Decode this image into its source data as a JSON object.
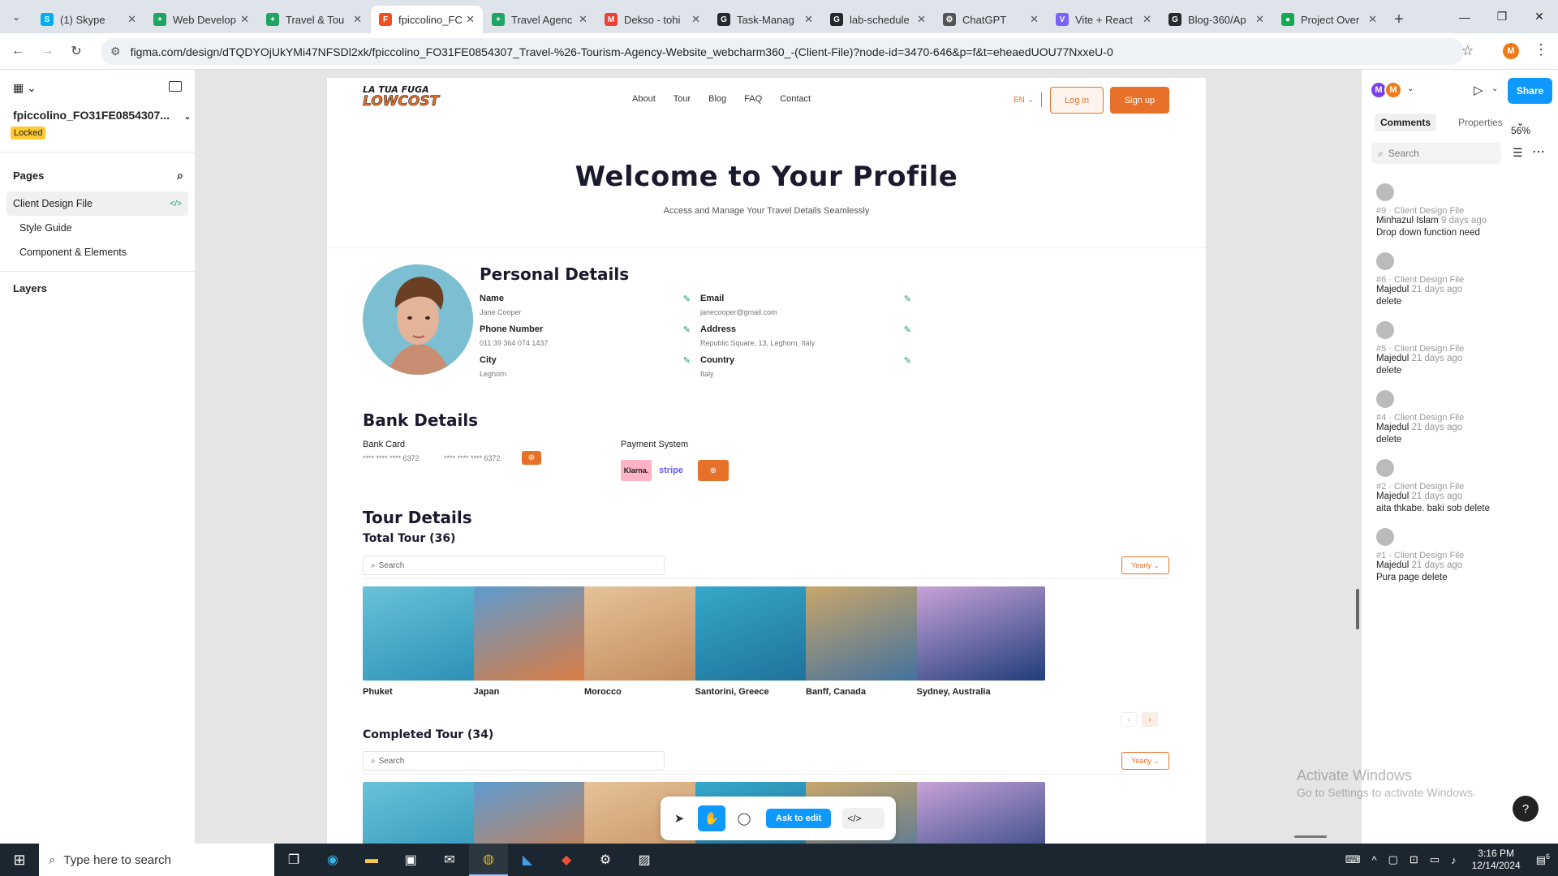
{
  "browser": {
    "tabs": [
      {
        "title": "(1) Skype",
        "icon": "skype",
        "color": "#00aff0",
        "letter": "S"
      },
      {
        "title": "Web Develop",
        "icon": "sheets",
        "color": "#1fa463",
        "letter": "+"
      },
      {
        "title": "Travel & Tou",
        "icon": "sheets",
        "color": "#1fa463",
        "letter": "+"
      },
      {
        "title": "fpiccolino_FC",
        "icon": "figma",
        "color": "#f24e1e",
        "letter": "F",
        "active": true
      },
      {
        "title": "Travel Agenc",
        "icon": "sheets",
        "color": "#1fa463",
        "letter": "+"
      },
      {
        "title": "Dekso - tohi",
        "icon": "gmail",
        "color": "#ea4335",
        "letter": "M"
      },
      {
        "title": "Task-Manag",
        "icon": "github",
        "color": "#24292e",
        "letter": "G"
      },
      {
        "title": "lab-schedule",
        "icon": "github",
        "color": "#24292e",
        "letter": "G"
      },
      {
        "title": "ChatGPT",
        "icon": "openai",
        "color": "#555",
        "letter": "⚙"
      },
      {
        "title": "Vite + React",
        "icon": "vite",
        "color": "#7b61ff",
        "letter": "V"
      },
      {
        "title": "Blog-360/Ap",
        "icon": "github",
        "color": "#24292e",
        "letter": "G"
      },
      {
        "title": "Project Over",
        "icon": "mongodb",
        "color": "#13aa52",
        "letter": "●"
      }
    ],
    "url": "figma.com/design/dTQDYOjUkYMi47NFSDl2xk/fpiccolino_FO31FE0854307_Travel-%26-Tourism-Agency-Website_webcharm360_-(Client-File)?node-id=3470-646&p=f&t=eheaedUOU77NxxeU-0",
    "profile_initial": "M"
  },
  "left_panel": {
    "file_name": "fpiccolino_FO31FE0854307...",
    "locked_badge": "Locked",
    "pages_label": "Pages",
    "pages": [
      "Client Design File",
      "Style Guide",
      "Component & Elements"
    ],
    "layers_label": "Layers"
  },
  "site": {
    "logo_top": "LA TUA FUGA",
    "logo_bottom": "LOWCOST",
    "nav": [
      "About",
      "Tour",
      "Blog",
      "FAQ",
      "Contact"
    ],
    "lang": "EN",
    "login": "Log in",
    "signup": "Sign up",
    "hero_title": "Welcome to Your Profile",
    "hero_sub": "Access and Manage Your Travel Details Seamlessly",
    "personal_title": "Personal Details",
    "fields": {
      "name": {
        "label": "Name",
        "value": "Jane Cooper"
      },
      "email": {
        "label": "Email",
        "value": "janecooper@gmail.com"
      },
      "phone": {
        "label": "Phone Number",
        "value": "011 39 364 074 1437"
      },
      "address": {
        "label": "Address",
        "value": "Republic Square, 13, Leghorn, Italy"
      },
      "city": {
        "label": "City",
        "value": "Leghorn"
      },
      "country": {
        "label": "Country",
        "value": "Italy"
      }
    },
    "bank_title": "Bank Details",
    "bank_card_label": "Bank Card",
    "card1": "**** **** **** 6372",
    "card2": "**** **** **** 6372",
    "payment_label": "Payment System",
    "klarna": "Klarna.",
    "stripe": "stripe",
    "tour_title": "Tour Details",
    "total_tour": "Total Tour (36)",
    "completed_tour": "Completed Tour (34)",
    "search_placeholder": "Search",
    "yearly": "Yearly",
    "tours": [
      "Phuket",
      "Japan",
      "Morocco",
      "Santorini, Greece",
      "Banff, Canada",
      "Sydney, Australia"
    ],
    "tour_colors": [
      [
        "#2a8fb5",
        "#69c2d8"
      ],
      [
        "#e07a3a",
        "#5d9bd0"
      ],
      [
        "#c08a5a",
        "#e6c299"
      ],
      [
        "#1f6f9a",
        "#35a8c8"
      ],
      [
        "#3d6fa0",
        "#c9a66a"
      ],
      [
        "#1f3d7a",
        "#c7a2d8"
      ]
    ]
  },
  "toolbar": {
    "ask_edit": "Ask to edit"
  },
  "right_panel": {
    "avatars": [
      {
        "letter": "M",
        "color": "#7b3ff2"
      },
      {
        "letter": "M",
        "color": "#f07a1a"
      }
    ],
    "share": "Share",
    "tabs": [
      "Comments",
      "Properties"
    ],
    "zoom": "56%",
    "search_placeholder": "Search",
    "comments": [
      {
        "meta": "#9 · Client Design File",
        "author": "Minhazul Islam",
        "ago": "9 days ago",
        "body": "Drop down function need"
      },
      {
        "meta": "#6 · Client Design File",
        "author": "Majedul",
        "ago": "21 days ago",
        "body": "delete"
      },
      {
        "meta": "#5 · Client Design File",
        "author": "Majedul",
        "ago": "21 days ago",
        "body": "delete"
      },
      {
        "meta": "#4 · Client Design File",
        "author": "Majedul",
        "ago": "21 days ago",
        "body": "delete"
      },
      {
        "meta": "#2 · Client Design File",
        "author": "Majedul",
        "ago": "21 days ago",
        "body": "aita thkabe. baki sob delete"
      },
      {
        "meta": "#1 · Client Design File",
        "author": "Majedul",
        "ago": "21 days ago",
        "body": "Pura page delete"
      }
    ],
    "help": "?"
  },
  "watermark": {
    "line1": "Activate Windows",
    "line2": "Go to Settings to activate Windows."
  },
  "taskbar": {
    "search_placeholder": "Type here to search",
    "time": "3:16 PM",
    "date": "12/14/2024",
    "notif_count": "6"
  }
}
